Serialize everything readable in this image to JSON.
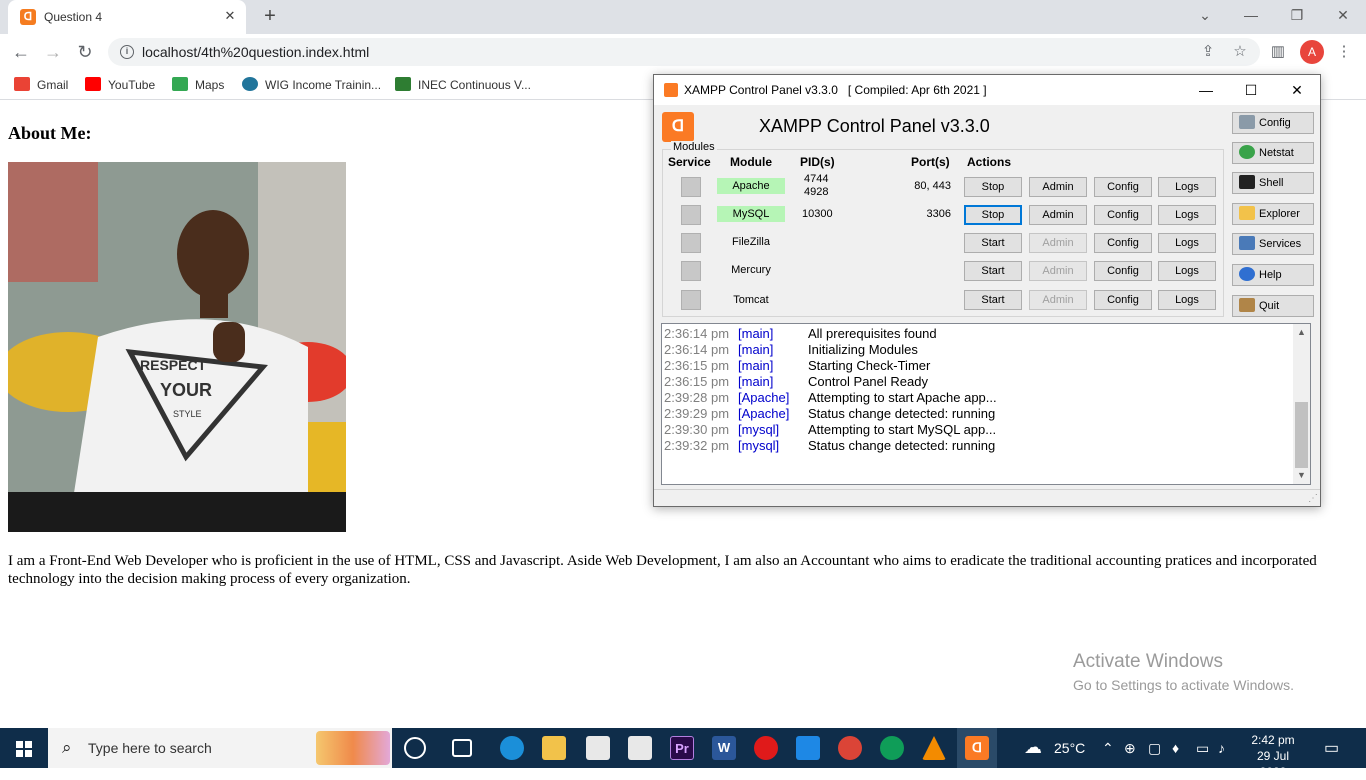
{
  "browser": {
    "tab_title": "Question 4",
    "url": "localhost/4th%20question.index.html",
    "bookmarks": [
      {
        "label": "Gmail",
        "color": "#ea4335"
      },
      {
        "label": "YouTube",
        "color": "#ff0000"
      },
      {
        "label": "Maps",
        "color": "#34a853"
      },
      {
        "label": "WIG Income Trainin...",
        "color": "#21759b"
      },
      {
        "label": "INEC Continuous V...",
        "color": "#2e7d32"
      }
    ],
    "profile_initial": "A"
  },
  "page": {
    "heading": "About Me:",
    "paragraph": "I am a Front-End Web Developer who is proficient in the use of HTML, CSS and Javascript. Aside Web Development, I am also an Accountant who aims to eradicate the traditional accounting pratices and incorporated technology into the decision making process of every organization.",
    "photo_text": [
      "RESPECT",
      "YOUR",
      "STYLE"
    ],
    "activate_title": "Activate Windows",
    "activate_sub": "Go to Settings to activate Windows."
  },
  "xampp": {
    "window_title": "XAMPP Control Panel v3.3.0   [ Compiled: Apr 6th 2021 ]",
    "header": "XAMPP Control Panel v3.3.0",
    "group_label": "Modules",
    "columns": {
      "service": "Service",
      "module": "Module",
      "pid": "PID(s)",
      "port": "Port(s)",
      "actions": "Actions"
    },
    "modules": [
      {
        "name": "Apache",
        "pid": "4744\n4928",
        "port": "80, 443",
        "action": "Stop",
        "admin": "Admin",
        "config": "Config",
        "logs": "Logs"
      },
      {
        "name": "MySQL",
        "pid": "10300",
        "port": "3306",
        "action": "Stop",
        "admin": "Admin",
        "config": "Config",
        "logs": "Logs"
      },
      {
        "name": "FileZilla",
        "pid": "",
        "port": "",
        "action": "Start",
        "admin": "Admin",
        "config": "Config",
        "logs": "Logs"
      },
      {
        "name": "Mercury",
        "pid": "",
        "port": "",
        "action": "Start",
        "admin": "Admin",
        "config": "Config",
        "logs": "Logs"
      },
      {
        "name": "Tomcat",
        "pid": "",
        "port": "",
        "action": "Start",
        "admin": "Admin",
        "config": "Config",
        "logs": "Logs"
      }
    ],
    "side_buttons": [
      "Config",
      "Netstat",
      "Shell",
      "Explorer",
      "Services",
      "Help",
      "Quit"
    ],
    "log": [
      {
        "time": "2:36:14 pm",
        "module": "[main]",
        "text": "All prerequisites found"
      },
      {
        "time": "2:36:14 pm",
        "module": "[main]",
        "text": "Initializing Modules"
      },
      {
        "time": "2:36:15 pm",
        "module": "[main]",
        "text": "Starting Check-Timer"
      },
      {
        "time": "2:36:15 pm",
        "module": "[main]",
        "text": "Control Panel Ready"
      },
      {
        "time": "2:39:28 pm",
        "module": "[Apache]",
        "text": "Attempting to start Apache app..."
      },
      {
        "time": "2:39:29 pm",
        "module": "[Apache]",
        "text": "Status change detected: running"
      },
      {
        "time": "2:39:30 pm",
        "module": "[mysql]",
        "text": "Attempting to start MySQL app..."
      },
      {
        "time": "2:39:32 pm",
        "module": "[mysql]",
        "text": "Status change detected: running"
      }
    ]
  },
  "taskbar": {
    "search_placeholder": "Type here to search",
    "temperature": "25°C",
    "time": "2:42 pm",
    "date": "29 Jul 2022"
  }
}
